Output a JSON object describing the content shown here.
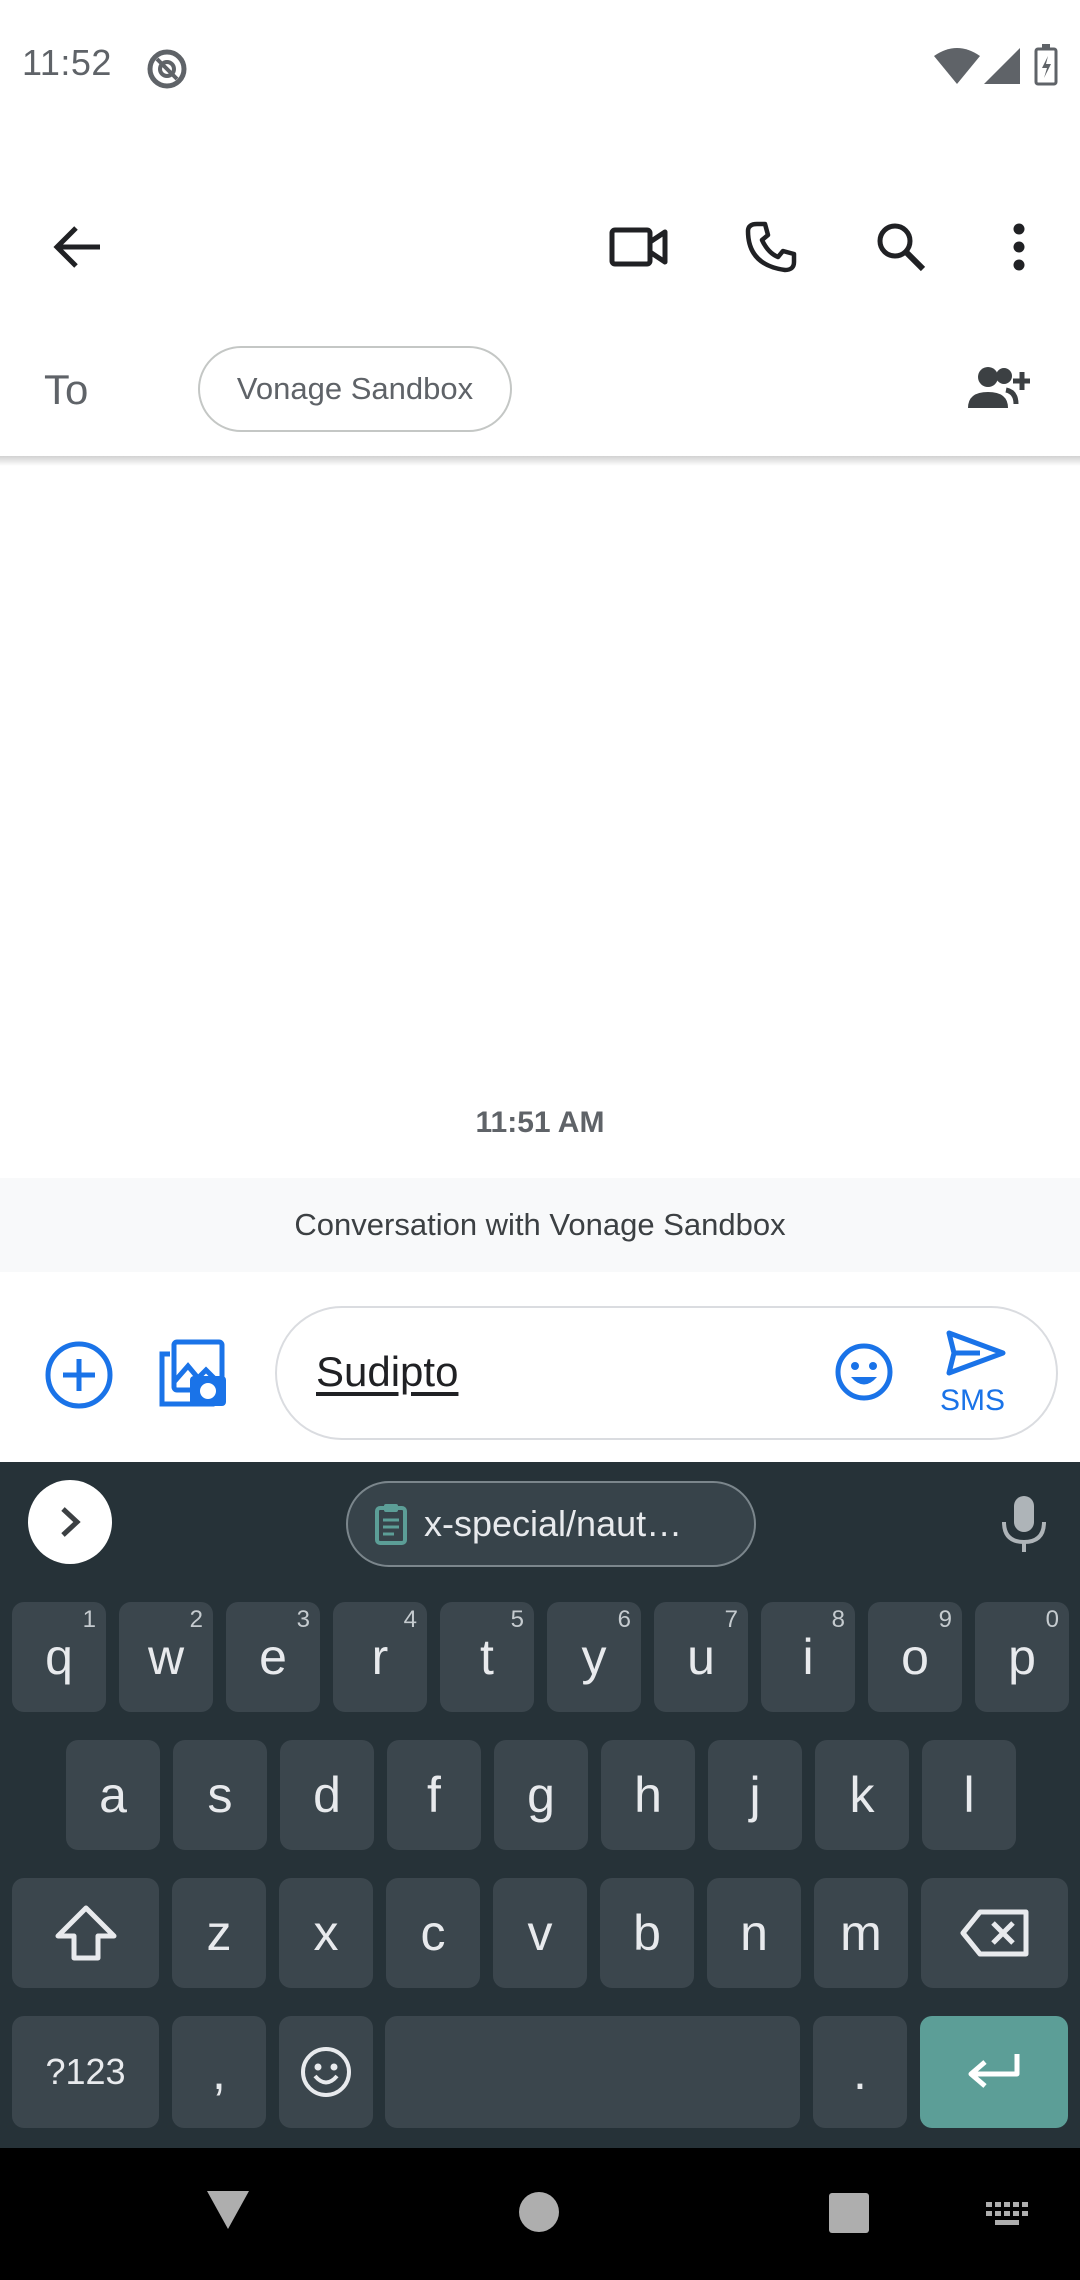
{
  "status_bar": {
    "time": "11:52"
  },
  "app_bar": {
    "icons": [
      "back-arrow-icon",
      "video-call-icon",
      "phone-icon",
      "search-icon",
      "more-vert-icon"
    ]
  },
  "recipient": {
    "to_label": "To",
    "chip": "Vonage Sandbox"
  },
  "conversation": {
    "timestamp": "11:51 AM",
    "banner": "Conversation with Vonage Sandbox"
  },
  "compose": {
    "text": "Sudipto",
    "send_label": "SMS",
    "accent": "#1a73e8"
  },
  "keyboard": {
    "clipboard_chip": "x-special/naut…",
    "row1": [
      {
        "k": "q",
        "h": "1"
      },
      {
        "k": "w",
        "h": "2"
      },
      {
        "k": "e",
        "h": "3"
      },
      {
        "k": "r",
        "h": "4"
      },
      {
        "k": "t",
        "h": "5"
      },
      {
        "k": "y",
        "h": "6"
      },
      {
        "k": "u",
        "h": "7"
      },
      {
        "k": "i",
        "h": "8"
      },
      {
        "k": "o",
        "h": "9"
      },
      {
        "k": "p",
        "h": "0"
      }
    ],
    "row2": [
      "a",
      "s",
      "d",
      "f",
      "g",
      "h",
      "j",
      "k",
      "l"
    ],
    "row3": [
      "z",
      "x",
      "c",
      "v",
      "b",
      "n",
      "m"
    ],
    "symbols_key": "?123",
    "comma_key": ",",
    "period_key": ".",
    "colors": {
      "background": "#263238",
      "key": "#3b464d",
      "enter": "#5c9e97"
    }
  }
}
